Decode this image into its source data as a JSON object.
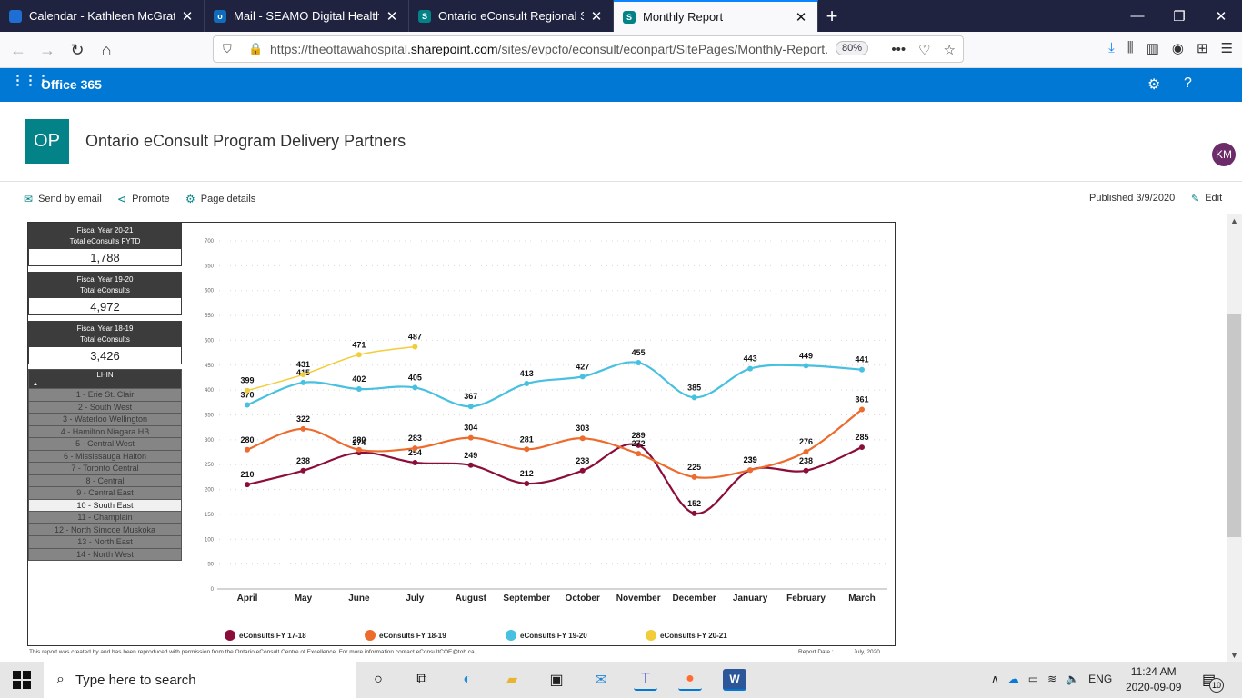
{
  "browser": {
    "tabs": [
      {
        "title": "Calendar - Kathleen McGrath - ",
        "icon": "outlook-calendar-icon",
        "color": "#1f6ed4"
      },
      {
        "title": "Mail - SEAMO Digital Health - C",
        "icon": "outlook-mail-icon",
        "color": "#0f6cbd"
      },
      {
        "title": "Ontario eConsult Regional Sites",
        "icon": "sharepoint-icon",
        "color": "#038387"
      },
      {
        "title": "Monthly Report",
        "icon": "sharepoint-icon",
        "color": "#038387"
      }
    ],
    "url_prefix": "https://theottawahospital.",
    "url_domain": "sharepoint.com",
    "url_rest": "/sites/evpcfo/econsult/econpart/SitePages/Monthly-Report.",
    "zoom": "80%"
  },
  "o365": {
    "brand": "Office 365",
    "avatar": "KM"
  },
  "site": {
    "logo": "OP",
    "title": "Ontario eConsult Program Delivery Partners"
  },
  "commands": {
    "send": "Send by email",
    "promote": "Promote",
    "details": "Page details",
    "published": "Published 3/9/2020",
    "edit": "Edit"
  },
  "kpis": [
    {
      "line1": "Fiscal Year 20-21",
      "line2": "Total eConsults FYTD",
      "value": "1,788"
    },
    {
      "line1": "Fiscal Year 19-20",
      "line2": "Total eConsults",
      "value": "4,972"
    },
    {
      "line1": "Fiscal Year 18-19",
      "line2": "Total eConsults",
      "value": "3,426"
    }
  ],
  "slicer": {
    "header": "LHIN",
    "items": [
      "1 - Erie St. Clair",
      "2 - South West",
      "3 - Waterloo Wellington",
      "4 - Hamilton Niagara HB",
      "5 - Central West",
      "6 - Mississauga Halton",
      "7 - Toronto Central",
      "8 - Central",
      "9 - Central East",
      "10 - South East",
      "11 - Champlain",
      "12 - North Simcoe Muskoka",
      "13 - North East",
      "14 - North West"
    ],
    "selected": "10 - South East"
  },
  "chart_data": {
    "type": "line",
    "title": "",
    "xlabel": "",
    "ylabel": "",
    "categories": [
      "April",
      "May",
      "June",
      "July",
      "August",
      "September",
      "October",
      "November",
      "December",
      "January",
      "February",
      "March"
    ],
    "ylim": [
      0,
      700
    ],
    "yticks": [
      0,
      50,
      100,
      150,
      200,
      250,
      300,
      350,
      400,
      450,
      500,
      550,
      600,
      650,
      700
    ],
    "grid": true,
    "legend": "bottom",
    "series": [
      {
        "name": "eConsults FY 17-18",
        "color": "#8b0e3a",
        "values": [
          210,
          238,
          274,
          254,
          249,
          212,
          238,
          289,
          152,
          239,
          238,
          285
        ]
      },
      {
        "name": "eConsults FY 18-19",
        "color": "#ec6b2d",
        "values": [
          280,
          322,
          280,
          283,
          304,
          281,
          303,
          272,
          225,
          239,
          276,
          361
        ]
      },
      {
        "name": "eConsults FY 19-20",
        "color": "#48c0e0",
        "values": [
          370,
          415,
          402,
          405,
          367,
          413,
          427,
          455,
          385,
          443,
          449,
          441
        ]
      },
      {
        "name": "eConsults FY 20-21",
        "color": "#f2cd3a",
        "values": [
          399,
          431,
          471,
          487
        ]
      }
    ]
  },
  "footer": {
    "note": "This report was created by and has been reproduced with permission from the Ontario eConsult Centre of Excellence. For more information contact eConsultCOE@toh.ca.",
    "date_label": "Report Date :",
    "date": "July, 2020"
  },
  "taskbar": {
    "search_placeholder": "Type here to search",
    "lang": "ENG",
    "time": "11:24 AM",
    "date": "2020-09-09",
    "notifications": "10"
  }
}
